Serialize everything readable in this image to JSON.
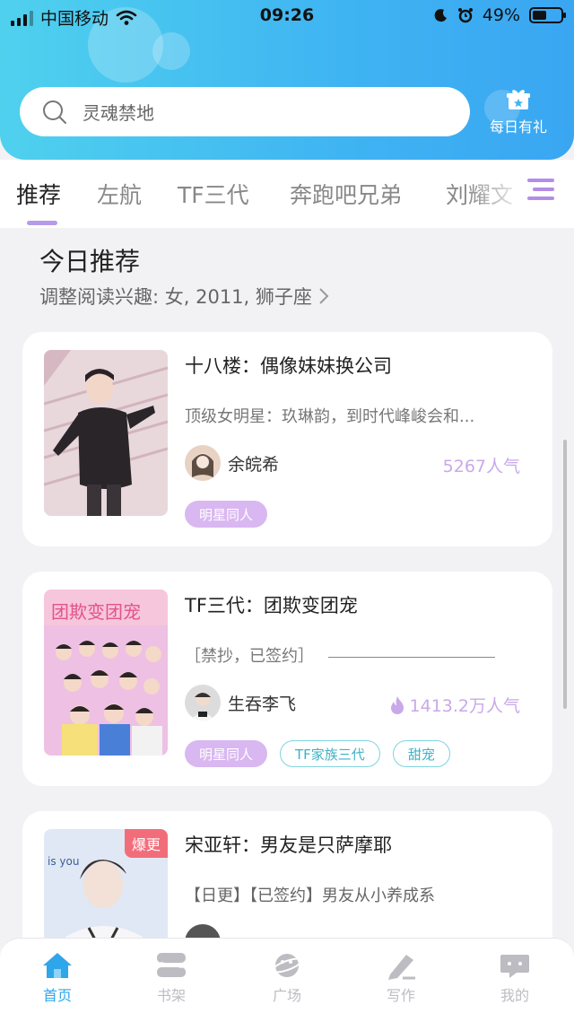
{
  "status_bar": {
    "carrier": "中国移动",
    "time": "09:26",
    "battery": "49%",
    "battery_level": 0.49
  },
  "search": {
    "placeholder": "灵魂禁地"
  },
  "gift": {
    "label": "每日有礼"
  },
  "tabs": [
    {
      "label": "推荐",
      "active": true
    },
    {
      "label": "左航",
      "active": false
    },
    {
      "label": "TF三代",
      "active": false
    },
    {
      "label": "奔跑吧兄弟",
      "active": false
    },
    {
      "label": "刘耀文",
      "active": false
    }
  ],
  "section": {
    "title": "今日推荐",
    "subtitle": "调整阅读兴趣: 女, 2011, 狮子座"
  },
  "books": [
    {
      "title": "十八楼：偶像妹妹换公司",
      "desc": "顶级女明星：玖琳韵，到时代峰峻会和...",
      "author": "余皖希",
      "popularity": "5267人气",
      "tags": [
        "明星同人"
      ]
    },
    {
      "title": "TF三代：团欺变团宠",
      "desc": "［禁抄，已签约］",
      "author": "生吞李飞",
      "popularity": "1413.2万人气",
      "cover_text": "团欺变团宠",
      "tags": [
        "明星同人",
        "TF家族三代",
        "甜宠"
      ]
    },
    {
      "title": "宋亚轩：男友是只萨摩耶",
      "desc": "【日更】【已签约】男友从小养成系",
      "author": "",
      "badge": "爆更",
      "cover_text": "is you",
      "tags": []
    }
  ],
  "bottom_nav": [
    {
      "label": "首页",
      "active": true,
      "icon": "home-icon"
    },
    {
      "label": "书架",
      "active": false,
      "icon": "bookshelf-icon"
    },
    {
      "label": "广场",
      "active": false,
      "icon": "planet-icon"
    },
    {
      "label": "写作",
      "active": false,
      "icon": "pen-icon"
    },
    {
      "label": "我的",
      "active": false,
      "icon": "profile-icon"
    }
  ],
  "colors": {
    "header": "#3fb4f2",
    "accent": "#2fa6ea",
    "tag_purple": "#d9b7f0",
    "tag_cyan": "#3db2c4",
    "popularity": "#c9a9ea"
  }
}
